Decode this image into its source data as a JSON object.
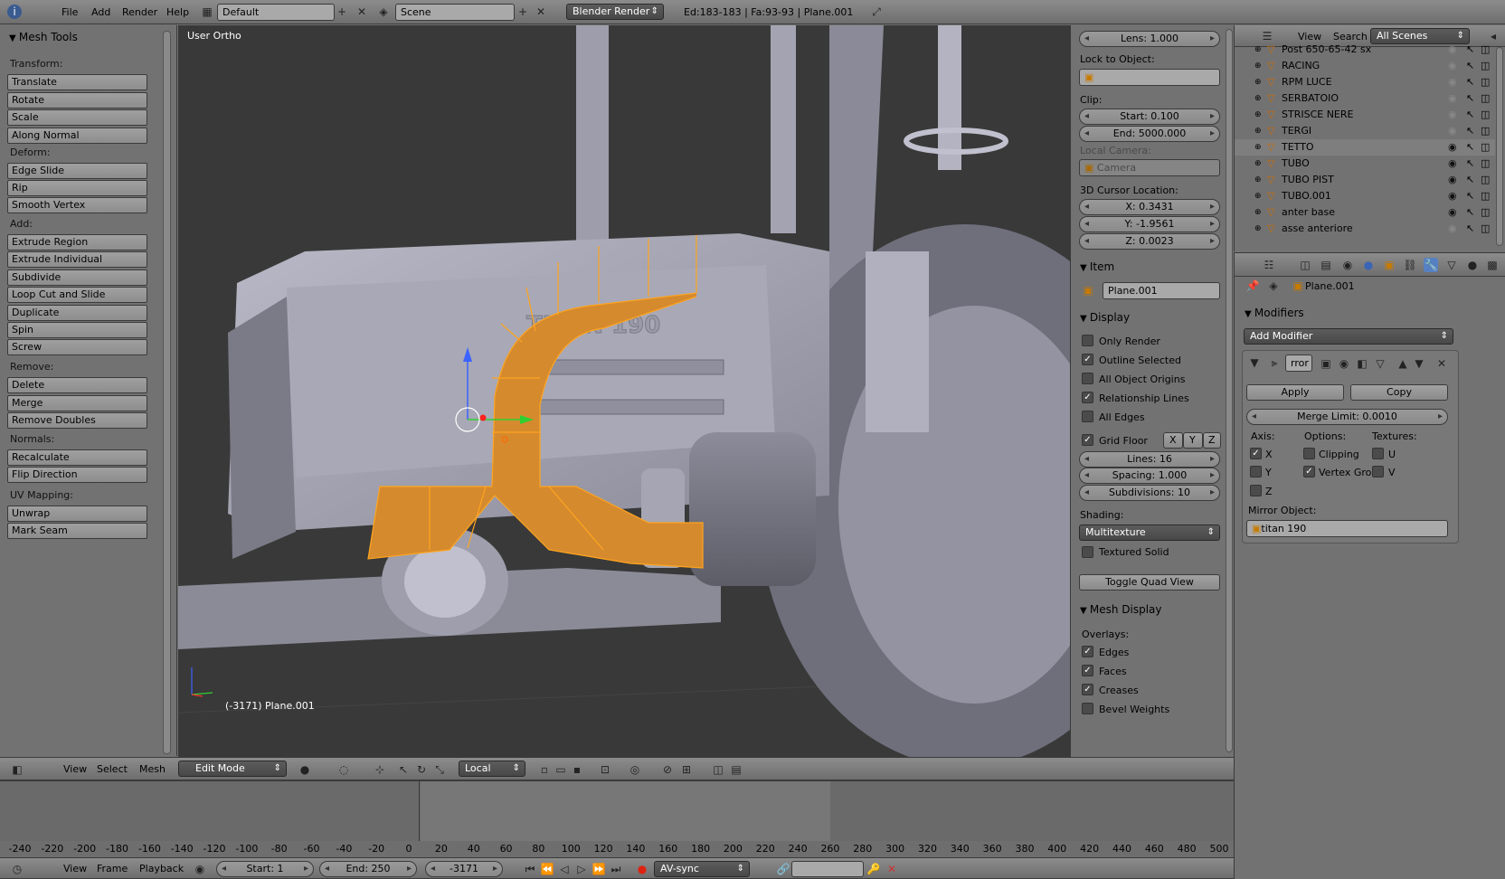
{
  "topbar": {
    "menus": [
      "File",
      "Add",
      "Render",
      "Help"
    ],
    "layout": "Default",
    "scene": "Scene",
    "engine": "Blender Render",
    "stats": "Ed:183-183 | Fa:93-93 | Plane.001"
  },
  "toolshelf": {
    "title": "Mesh Tools",
    "groups": [
      {
        "label": "Transform:",
        "items": [
          "Translate",
          "Rotate",
          "Scale",
          "Along Normal"
        ]
      },
      {
        "label": "Deform:",
        "items": [
          "Edge Slide",
          "Rip",
          "Smooth Vertex"
        ]
      },
      {
        "label": "Add:",
        "items": [
          "Extrude Region",
          "Extrude Individual",
          "Subdivide",
          "Loop Cut and Slide",
          "Duplicate",
          "Spin",
          "Screw"
        ]
      },
      {
        "label": "Remove:",
        "items": [
          "Delete",
          "Merge",
          "Remove Doubles"
        ]
      },
      {
        "label": "Normals:",
        "items": [
          "Recalculate",
          "Flip Direction"
        ]
      },
      {
        "label": "UV Mapping:",
        "items": [
          "Unwrap",
          "Mark Seam"
        ]
      }
    ]
  },
  "viewport": {
    "view_name": "User Ortho",
    "status": "(-3171) Plane.001",
    "model_text": "TITAN 190"
  },
  "properties_n": {
    "lens": "Lens: 1.000",
    "lock_label": "Lock to Object:",
    "clip_label": "Clip:",
    "clip_start": "Start: 0.100",
    "clip_end": "End: 5000.000",
    "local_camera_label": "Local Camera:",
    "local_camera": "Camera",
    "cursor_label": "3D Cursor Location:",
    "cursor_x": "X: 0.3431",
    "cursor_y": "Y: -1.9561",
    "cursor_z": "Z: 0.0023",
    "item_title": "Item",
    "item_name": "Plane.001",
    "display_title": "Display",
    "display_checks": [
      {
        "label": "Only Render",
        "checked": false
      },
      {
        "label": "Outline Selected",
        "checked": true
      },
      {
        "label": "All Object Origins",
        "checked": false
      },
      {
        "label": "Relationship Lines",
        "checked": true
      },
      {
        "label": "All Edges",
        "checked": false
      }
    ],
    "grid_floor": "Grid Floor",
    "axes": [
      "X",
      "Y",
      "Z"
    ],
    "lines": "Lines: 16",
    "spacing": "Spacing: 1.000",
    "subdivisions": "Subdivisions: 10",
    "shading_label": "Shading:",
    "shading": "Multitexture",
    "textured_solid": "Textured Solid",
    "toggle_quad": "Toggle Quad View",
    "mesh_display_title": "Mesh Display",
    "overlays_label": "Overlays:",
    "overlays": [
      {
        "label": "Edges",
        "checked": true
      },
      {
        "label": "Faces",
        "checked": true
      },
      {
        "label": "Creases",
        "checked": true
      },
      {
        "label": "Bevel Weights",
        "checked": false
      }
    ]
  },
  "outliner": {
    "menus": [
      "View",
      "Search"
    ],
    "scope": "All Scenes",
    "items": [
      {
        "name": "Post 650-65-42 sx",
        "visible": false
      },
      {
        "name": "RACING",
        "visible": false
      },
      {
        "name": "RPM LUCE",
        "visible": false
      },
      {
        "name": "SERBATOIO",
        "visible": false
      },
      {
        "name": "STRISCE NERE",
        "visible": false
      },
      {
        "name": "TERGI",
        "visible": false
      },
      {
        "name": "TETTO",
        "visible": true
      },
      {
        "name": "TUBO",
        "visible": true
      },
      {
        "name": "TUBO PIST",
        "visible": true
      },
      {
        "name": "TUBO.001",
        "visible": true
      },
      {
        "name": "anter base",
        "visible": true
      },
      {
        "name": "asse anteriore",
        "visible": false
      }
    ]
  },
  "modifiers": {
    "object": "Plane.001",
    "title": "Modifiers",
    "add": "Add Modifier",
    "mod_name": "rror",
    "apply": "Apply",
    "copy": "Copy",
    "merge_limit": "Merge Limit: 0.0010",
    "axis_label": "Axis:",
    "options_label": "Options:",
    "textures_label": "Textures:",
    "axis_x": "X",
    "axis_y": "Y",
    "axis_z": "Z",
    "clipping": "Clipping",
    "vertex_groups": "Vertex Grou",
    "tex_u": "U",
    "tex_v": "V",
    "mirror_label": "Mirror Object:",
    "mirror_object": "titan 190"
  },
  "view3d_header": {
    "menus": [
      "View",
      "Select",
      "Mesh"
    ],
    "mode": "Edit Mode",
    "orientation": "Local"
  },
  "timeline": {
    "ticks": [
      "-240",
      "-220",
      "-200",
      "-180",
      "-160",
      "-140",
      "-120",
      "-100",
      "-80",
      "-60",
      "-40",
      "-20",
      "0",
      "20",
      "40",
      "60",
      "80",
      "100",
      "120",
      "140",
      "160",
      "180",
      "200",
      "220",
      "240",
      "260",
      "280",
      "300",
      "320",
      "340",
      "360",
      "380",
      "400",
      "420",
      "440",
      "460",
      "480",
      "500"
    ],
    "menus": [
      "View",
      "Frame",
      "Playback"
    ],
    "start": "Start: 1",
    "end": "End: 250",
    "current": "-3171",
    "sync": "AV-sync"
  }
}
